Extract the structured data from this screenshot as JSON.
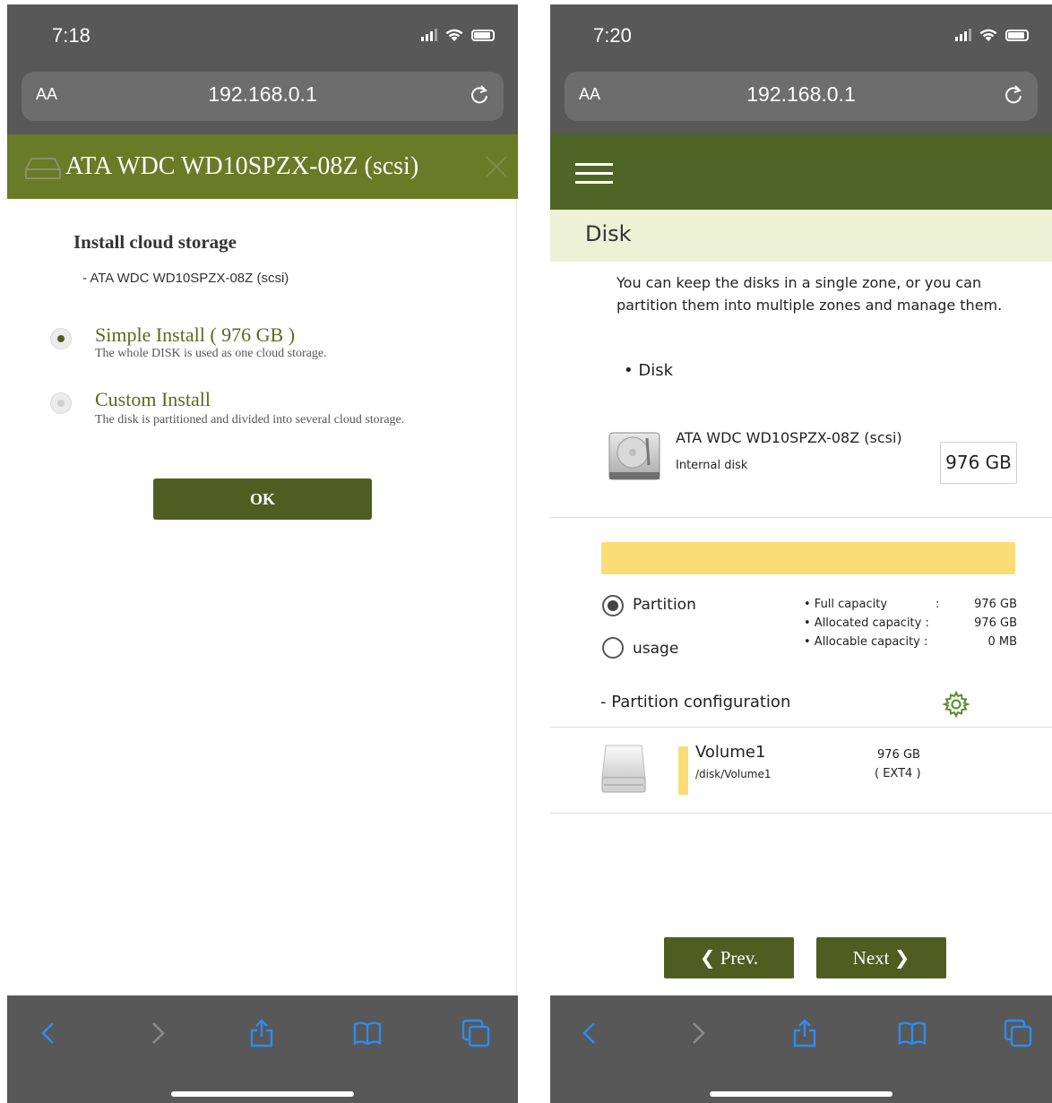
{
  "left_screen": {
    "status": {
      "time": "7:18"
    },
    "address": {
      "aa": "AA",
      "url": "192.168.0.1"
    },
    "dialog": {
      "title": "ATA WDC WD10SPZX-08Z (scsi)",
      "heading": "Install cloud storage",
      "subheading": "- ATA WDC WD10SPZX-08Z (scsi)",
      "options": [
        {
          "label": "Simple Install ( 976 GB )",
          "description": "The whole DISK is used as one cloud storage.",
          "selected": true
        },
        {
          "label": "Custom Install",
          "description": "The disk is partitioned and divided into several cloud storage.",
          "selected": false
        }
      ],
      "ok_label": "OK"
    },
    "toolbar_icons": [
      "back-icon",
      "forward-icon",
      "share-icon",
      "bookmarks-icon",
      "tabs-icon"
    ]
  },
  "right_screen": {
    "status": {
      "time": "7:20"
    },
    "address": {
      "aa": "AA",
      "url": "192.168.0.1"
    },
    "page_title": "Disk",
    "intro": "You can keep the disks in a single zone, or you can partition them into multiple zones and manage them.",
    "bullet": "• Disk",
    "disk": {
      "name": "ATA WDC WD10SPZX-08Z (scsi)",
      "type": "Internal disk",
      "capacity": "976 GB"
    },
    "usage_fraction": 1.0,
    "view_options": [
      {
        "label": "Partition",
        "selected": true
      },
      {
        "label": "usage",
        "selected": false
      }
    ],
    "capacity_info": [
      {
        "label": "• Full capacity",
        "sep": ":",
        "value": "976 GB"
      },
      {
        "label": "• Allocated capacity :",
        "sep": "",
        "value": "976 GB"
      },
      {
        "label": "• Allocable capacity :",
        "sep": "",
        "value": "0 MB"
      }
    ],
    "partition_config_label": "- Partition configuration",
    "volume": {
      "name": "Volume1",
      "path": "/disk/Volume1",
      "size": "976 GB",
      "fs": "( EXT4 )"
    },
    "prev_label": "Prev.",
    "next_label": "Next",
    "colors": {
      "nav": "#4e6525",
      "button": "#4f5e20",
      "usage": "#fcdc76",
      "header_bg": "#edf2d7"
    }
  }
}
